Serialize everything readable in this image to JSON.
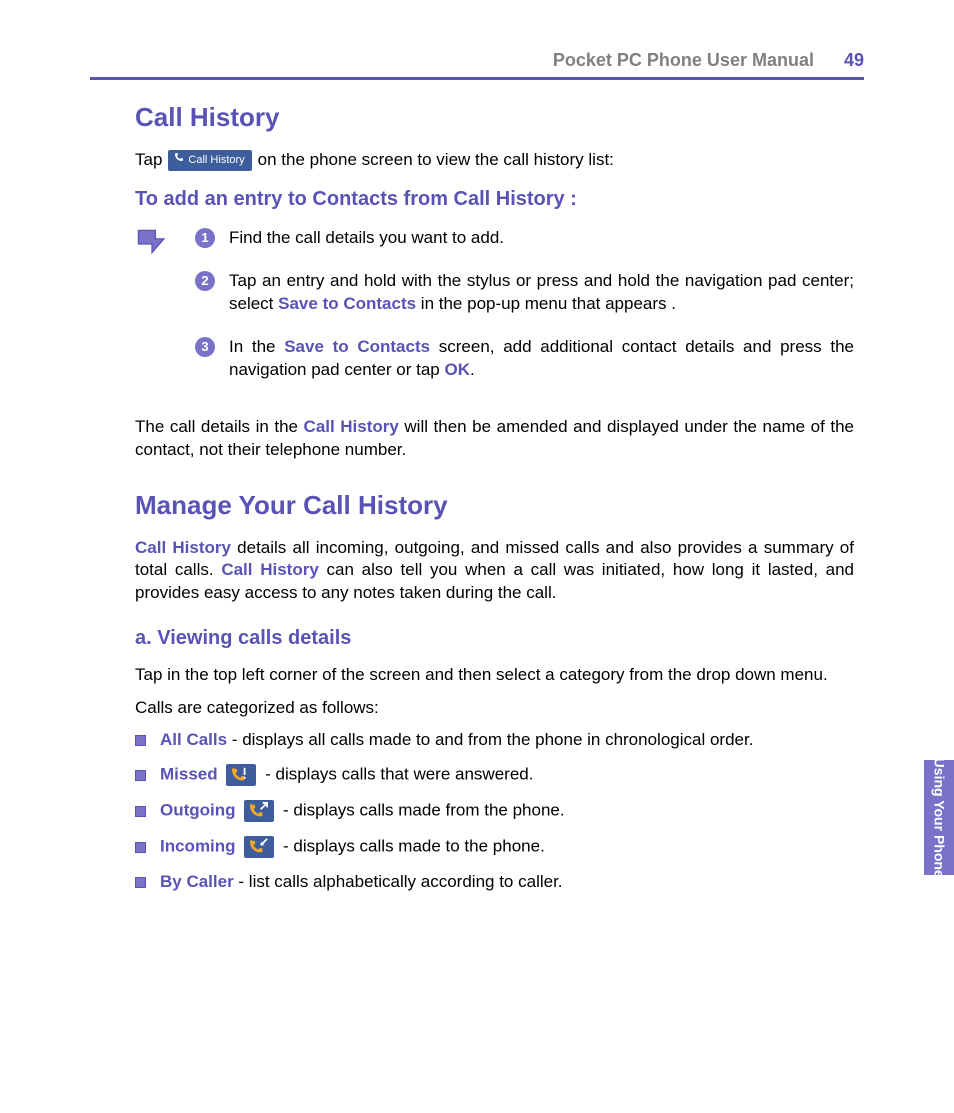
{
  "header": {
    "title": "Pocket PC Phone User Manual",
    "page_number": "49"
  },
  "side_tab": "Using Your\nPhone",
  "section1": {
    "title": "Call History",
    "intro_pre": "Tap",
    "button_label": "Call History",
    "intro_post": "on the phone screen to view the call history list:",
    "sub_title": "To add an entry to Contacts from Call History :",
    "steps": [
      {
        "n": "1",
        "text": "Find the call details you want to add."
      },
      {
        "n": "2",
        "pre": "Tap an entry and hold with the stylus or press and hold the navigation pad center; select  ",
        "link": "Save to Contacts",
        "post": " in the pop-up menu that appears ."
      },
      {
        "n": "3",
        "pre": "In the ",
        "link": "Save to Contacts",
        "mid": " screen, add additional contact details and press the navigation pad center or tap ",
        "link2": "OK",
        "post": "."
      }
    ],
    "closing_pre": "The call details in the ",
    "closing_link": "Call History",
    "closing_post": " will then be amended and displayed under the name of the contact, not their telephone number."
  },
  "section2": {
    "title": "Manage Your Call History",
    "intro_link1": "Call History",
    "intro_mid1": " details all incoming, outgoing, and missed calls and also provides a summary of total calls.  ",
    "intro_link2": "Call History",
    "intro_post": " can also tell you when a call was initiated, how long it lasted, and provides easy access to any notes taken during the call.",
    "subsub": "a.  Viewing calls details",
    "p1": "Tap in the top left corner of the screen and then select a category from the drop down menu.",
    "p2": "Calls are categorized as follows:",
    "bullets": [
      {
        "label": "All Calls",
        "rest": " - displays all calls made to and from the phone in chronological order.",
        "icon": false
      },
      {
        "label": "Missed",
        "rest": "  - displays calls that were answered.",
        "icon": true,
        "icon_type": "missed"
      },
      {
        "label": "Outgoing",
        "rest": "  - displays calls made from the phone.",
        "icon": true,
        "icon_type": "outgoing"
      },
      {
        "label": "Incoming",
        "rest": "  - displays calls made to the phone.",
        "icon": true,
        "icon_type": "incoming"
      },
      {
        "label": "By Caller",
        "rest": " - list calls alphabetically according to caller.",
        "icon": false
      }
    ]
  }
}
